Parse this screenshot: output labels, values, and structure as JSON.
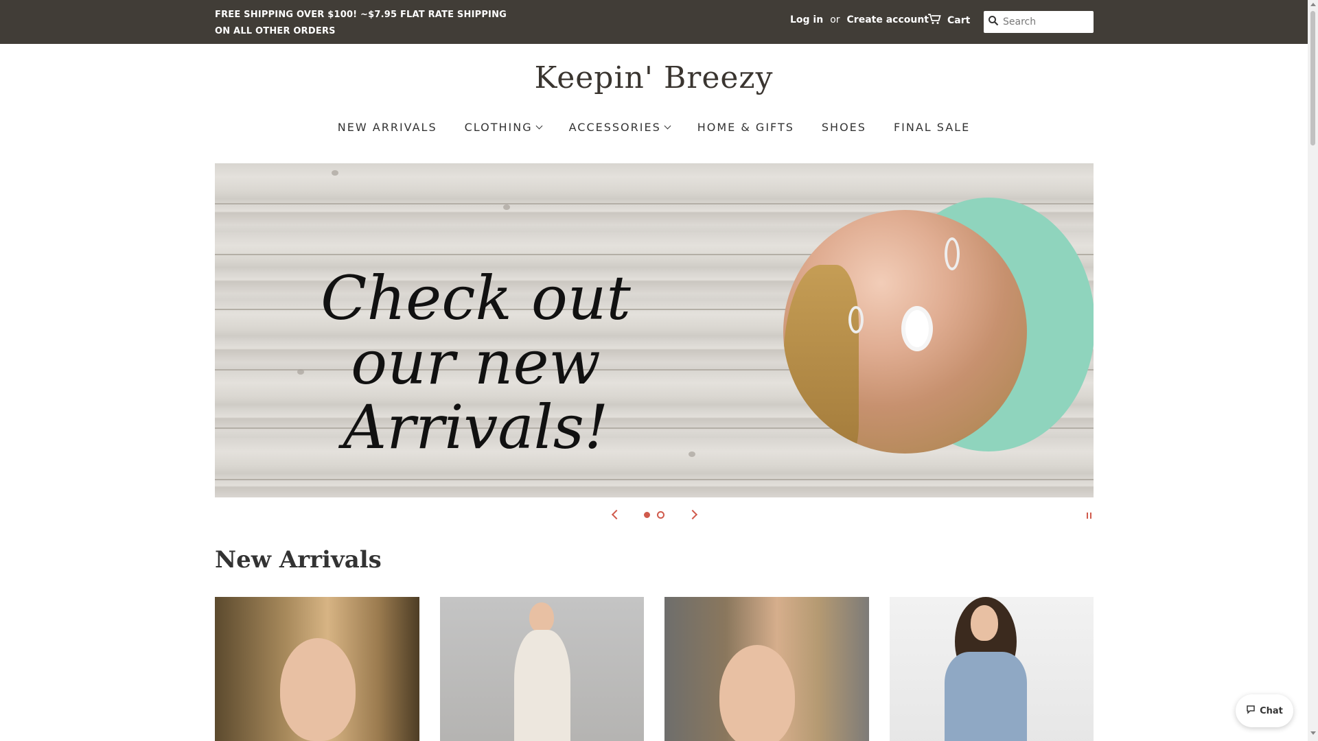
{
  "announcement": "FREE SHIPPING OVER $100! ~$7.95 FLAT RATE SHIPPING ON ALL OTHER ORDERS",
  "account": {
    "login": "Log in",
    "or": "or",
    "create": "Create account"
  },
  "cart": {
    "label": "Cart",
    "icon": "cart-icon"
  },
  "search": {
    "placeholder": "Search",
    "icon": "search-icon"
  },
  "logo": "Keepin' Breezy",
  "nav": {
    "items": [
      {
        "label": "NEW ARRIVALS",
        "dropdown": false
      },
      {
        "label": "CLOTHING",
        "dropdown": true
      },
      {
        "label": "ACCESSORIES",
        "dropdown": true
      },
      {
        "label": "HOME & GIFTS",
        "dropdown": false
      },
      {
        "label": "SHOES",
        "dropdown": false
      },
      {
        "label": "FINAL SALE",
        "dropdown": false
      }
    ]
  },
  "hero": {
    "text_line1": "Check out our new",
    "text_line2": "Arrivals!",
    "slide_count": 2,
    "active_slide": 1
  },
  "section": {
    "title": "New Arrivals"
  },
  "chat": {
    "label": "Chat"
  },
  "colors": {
    "topbar": "#413d37",
    "accent": "#d05a4c",
    "mint": "#8fd4bd"
  }
}
